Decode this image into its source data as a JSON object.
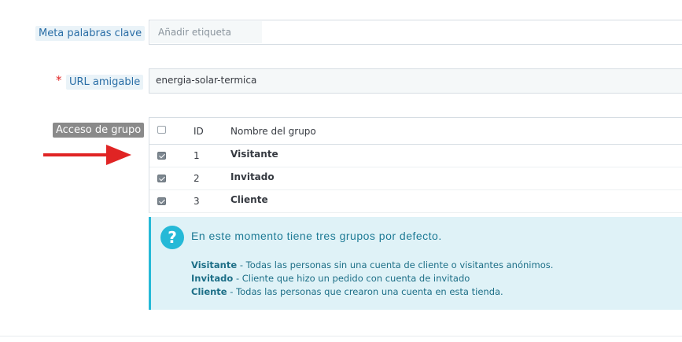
{
  "meta_keywords": {
    "label": "Meta palabras clave",
    "placeholder": "Añadir etiqueta"
  },
  "friendly_url": {
    "required_mark": "*",
    "label": "URL amigable",
    "value": "energia-solar-termica"
  },
  "group_access": {
    "label": "Acceso de grupo",
    "headers": {
      "id": "ID",
      "name": "Nombre del grupo"
    },
    "header_checked": false,
    "rows": [
      {
        "id": "1",
        "name": "Visitante",
        "checked": true
      },
      {
        "id": "2",
        "name": "Invitado",
        "checked": true
      },
      {
        "id": "3",
        "name": "Cliente",
        "checked": true
      }
    ]
  },
  "info": {
    "icon": "question-icon",
    "icon_glyph": "?",
    "title": "En este momento tiene tres grupos por defecto.",
    "lines": [
      {
        "name": "Visitante",
        "text": " - Todas las personas sin una cuenta de cliente o visitantes anónimos."
      },
      {
        "name": "Invitado",
        "text": " - Cliente que hizo un pedido con cuenta de invitado"
      },
      {
        "name": "Cliente",
        "text": " - Todas las personas que crearon una cuenta en esta tienda."
      }
    ]
  },
  "colors": {
    "accent": "#25b9d7",
    "arrow": "#e02424",
    "info_bg": "#dff2f7"
  }
}
